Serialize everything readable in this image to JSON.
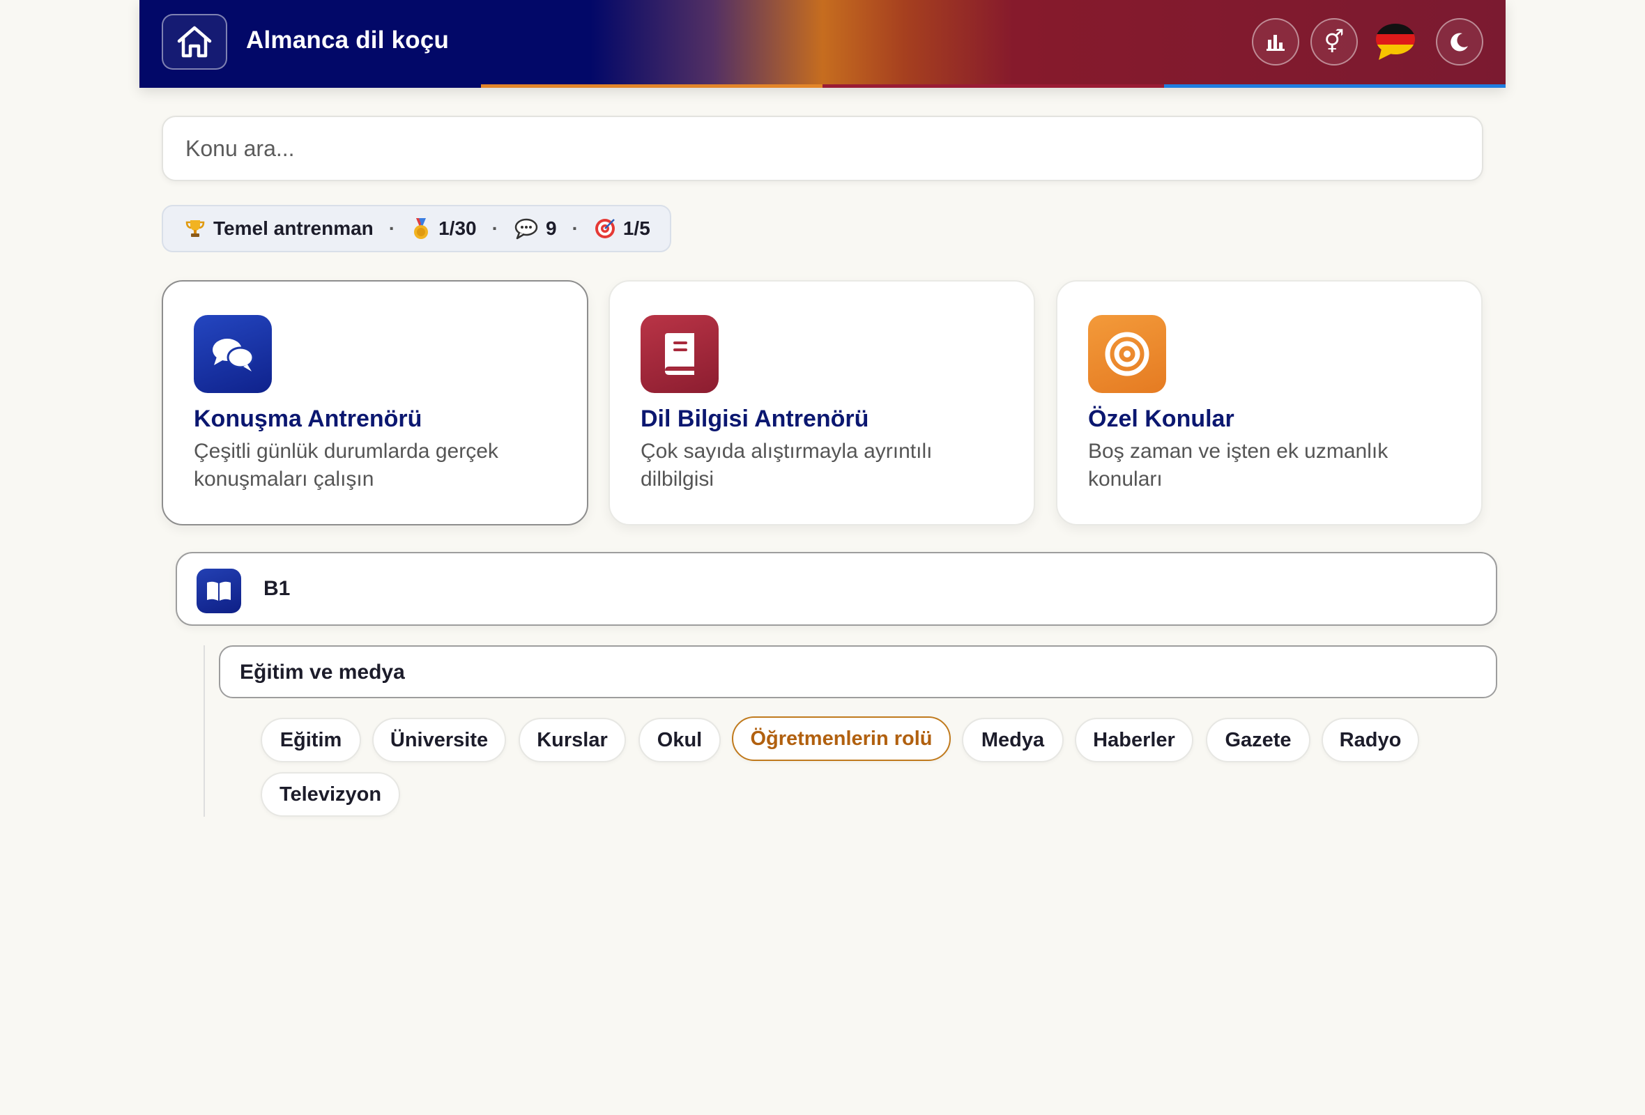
{
  "header": {
    "app_title": "Almanca dil koçu",
    "gradient_colors": [
      "#020868",
      "#c66d1f",
      "#861a2c"
    ],
    "strip_colors": [
      "#020868",
      "#e3862a",
      "#9a1c35",
      "#1f7ee0"
    ],
    "buttons": {
      "home": "home-icon",
      "stats": "bar-chart-icon",
      "gender": "gender-icon",
      "language": "german-flag-icon",
      "theme": "moon-icon"
    }
  },
  "search": {
    "placeholder": "Konu ara..."
  },
  "stats": {
    "level_label": "Temel antrenman",
    "medals": "1/30",
    "conversations": "9",
    "goals": "1/5"
  },
  "cards": [
    {
      "title": "Konuşma Antrenörü",
      "description": "Çeşitli günlük durumlarda gerçek konuşmaları çalışın",
      "icon": "chat-bubbles-icon",
      "color": "#1a36a6"
    },
    {
      "title": "Dil Bilgisi Antrenörü",
      "description": "Çok sayıda alıştırmayla ayrıntılı dilbilgisi",
      "icon": "book-icon",
      "color": "#a82a3c"
    },
    {
      "title": "Özel Konular",
      "description": "Boş zaman ve işten ek uzmanlık konuları",
      "icon": "target-icon",
      "color": "#ee8a2c"
    }
  ],
  "level": {
    "label": "B1",
    "icon": "open-book-icon"
  },
  "group": {
    "label": "Eğitim ve medya"
  },
  "topics": [
    "Eğitim",
    "Üniversite",
    "Kurslar",
    "Okul",
    "Öğretmenlerin rolü",
    "Medya",
    "Haberler",
    "Gazete",
    "Radyo",
    "Televizyon"
  ],
  "selected_topic": "Öğretmenlerin rolü",
  "accent_color": "#c07a1d"
}
